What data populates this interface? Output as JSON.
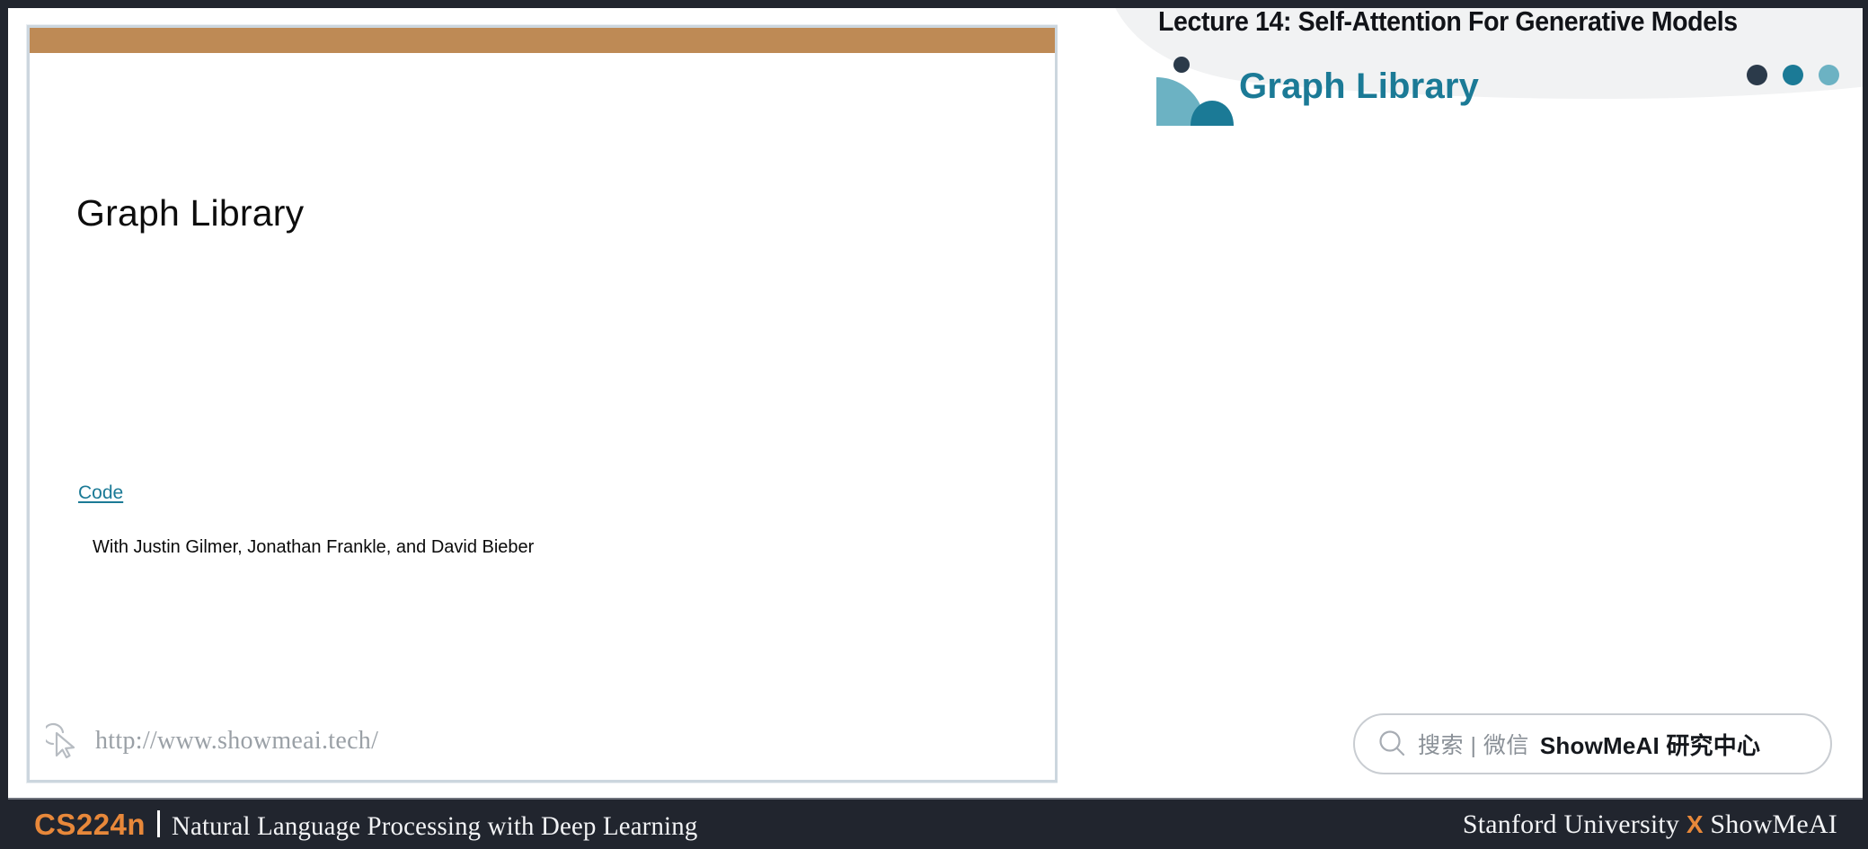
{
  "window": {
    "background": "#ffffff",
    "frame_color": "#21252e"
  },
  "slide": {
    "accent_bar_color": "#be8a55",
    "border_color": "#ccd6de",
    "title": "Graph Library",
    "code_link_label": "Code",
    "code_link_color": "#1b7a96",
    "credits": "With Justin Gilmer, Jonathan Frankle, and David Bieber",
    "watermark": {
      "icon": "cursor-icon",
      "url": "http://www.showmeai.tech/"
    }
  },
  "header": {
    "lecture_title": "Lecture 14:  Self-Attention For Generative Models",
    "logo": {
      "icon": "graph-library-logo-icon",
      "wordmark": "Graph Library",
      "wordmark_color": "#1b7a96",
      "shape_light_color": "#6cb2c3",
      "shape_dark_color": "#1b7a96",
      "dot_color": "#2b3a4a"
    },
    "dots": [
      {
        "name": "dot-navy",
        "color": "#2b3a4a"
      },
      {
        "name": "dot-teal",
        "color": "#1b7a96"
      },
      {
        "name": "dot-light-teal",
        "color": "#6cb2c3"
      }
    ]
  },
  "search": {
    "icon": "search-icon",
    "placeholder": "搜索 | 微信",
    "brand": "ShowMeAI 研究中心"
  },
  "footer": {
    "background": "#21252e",
    "accent_color": "#e8883a",
    "course_code": "CS224n",
    "course_subtitle": "Natural Language Processing with Deep Learning",
    "right_prefix": "Stanford University ",
    "right_x": "X",
    "right_suffix": " ShowMeAI"
  }
}
